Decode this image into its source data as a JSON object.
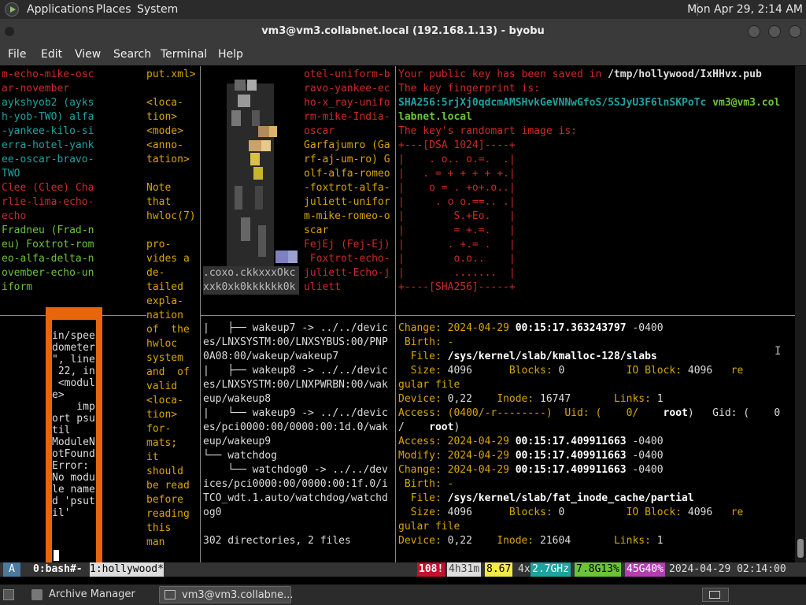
{
  "topbar": {
    "menus": [
      "Applications",
      "Places",
      "System"
    ],
    "clock": "Mon Apr 29,  2:14 AM"
  },
  "window": {
    "title": "vm3@vm3.collabnet.local (192.168.1.13) - byobu"
  },
  "menubar": [
    "File",
    "Edit",
    "View",
    "Search",
    "Terminal",
    "Help"
  ],
  "pane1": "m-echo-mike-osc\nar-november\naykshyob2 (ayks\nh-yob-TWO) alfa\n-yankee-kilo-si\nerra-hotel-yank\nee-oscar-bravo-\nTWO\nClee (Clee) Cha\nrlie-lima-echo-\necho\nFradneu (Frad-n\neu) Foxtrot-rom\neo-alfa-delta-n\november-echo-un\niform",
  "pane2": "put.xml>\n\n<loca-\ntion>\n<mode>\n<anno-\ntation>\n\nNote\nthat\nhwloc(7)\n\npro-\nvides a\nde-\ntailed\nexpla-\nnation\nof  the\nhwloc\nsystem\nand  of\nvalid\n<loca-\ntion>\nfor-\nmats;\nit\nshould\nbe read\nbefore\nreading\nthis\nman",
  "pane3_caption": ".coxo.ckkxxxOkc\nxxk0xk0kkkkkk0k",
  "pane4": "otel-uniform-b\nravo-yankee-ec\nho-x_ray-unifo\nrm-mike-India-\noscar\nGarfajumro (Ga\nrf-aj-um-ro) G\nolf-alfa-romeo\n-foxtrot-alfa-\njuliett-unifor\nm-mike-romeo-o\nscar\nFejEj (Fej-Ej)\n Foxtrot-echo-\njuliett-Echo-j\nuliett",
  "pane5": {
    "l1a": "Your public key has been saved in ",
    "l1b": "/tmp/hollywood/IxHHvx.pub",
    "l2": "The key fingerprint is:",
    "l3a": "SHA256:5rjXj0qdcmAMSHvkGeVNNwGfoS/5SJyU3F6lnSKPoTc",
    "l3b": " vm3@vm3.col",
    "l4": "labnet.local",
    "l5": "The key's randomart image is:",
    "art": "+---[DSA 1024]----+\n|    . o.. o.=.  .|\n|   . = + + + + +.|\n|    o = . +o+.o..|\n|     . o o.==.. .|\n|        S.+Eo.   |\n|        = +.=.   |\n|       . +.= .   |\n|        o.o..    |\n|        .......  |\n+----[SHA256]-----+"
  },
  "pane6": "in/spee\ndometer\n\", line\n 22, in\n <modul\ne>\n    imp\nort psu\ntil\nModuleN\notFound\nError:\nNo modu\nle name\nd 'psut\nil'",
  "pane7": "|   ├── wakeup7 -> ../../devic\nes/LNXSYSTM:00/LNXSYBUS:00/PNP\n0A08:00/wakeup/wakeup7\n|   ├── wakeup8 -> ../../devic\nes/LNXSYSTM:00/LNXPWRBN:00/wak\neup/wakeup8\n|   └── wakeup9 -> ../../devic\nes/pci0000:00/0000:00:1d.0/wak\neup/wakeup9\n└── watchdog\n    └── watchdog0 -> ../../dev\nices/pci0000:00/0000:00:1f.0/i\nTCO_wdt.1.auto/watchdog/watchd\nog0\n\n302 directories, 2 files",
  "pane8": [
    [
      "Change: ",
      "2024-04-29 ",
      "00:15:17.363243797",
      " -0400"
    ],
    [
      " Birth: -"
    ],
    [
      "  File: ",
      "/sys/kernel/slab/kmalloc-128/slabs"
    ],
    [
      "  Size: ",
      "4096",
      "      Blocks: ",
      "0",
      "          IO Block: ",
      "4096",
      "   re"
    ],
    [
      "gular file"
    ],
    [
      "Device: ",
      "0,22",
      "    Inode: ",
      "16747",
      "       Links: ",
      "1"
    ],
    [
      "Access: (0400/-r--------)  Uid: (    0/    ",
      "root",
      ")   Gid: (    0"
    ],
    [
      "/    ",
      "root",
      ")"
    ],
    [
      "Access: ",
      "2024-04-29 ",
      "00:15:17.409911663",
      " -0400"
    ],
    [
      "Modify: ",
      "2024-04-29 ",
      "00:15:17.409911663",
      " -0400"
    ],
    [
      "Change: ",
      "2024-04-29 ",
      "00:15:17.409911663",
      " -0400"
    ],
    [
      " Birth: -"
    ],
    [
      "  File: ",
      "/sys/kernel/slab/fat_inode_cache/partial"
    ],
    [
      "  Size: ",
      "4096",
      "      Blocks: ",
      "0",
      "          IO Block: ",
      "4096",
      "   re"
    ],
    [
      "gular file"
    ],
    [
      "Device: ",
      "0,22",
      "    Inode: ",
      "21604",
      "       Links: ",
      "1"
    ]
  ],
  "status": {
    "a": "A",
    "w0": "0:bash#-",
    "w1": "1:hollywood*",
    "s1": "108!",
    "s2": "4h31m",
    "s3": "8.67",
    "s4a": "4x",
    "s4b": "2.7GHz",
    "s5": "7.8G13%",
    "s6": "45G40%",
    "s7": "2024-04-29 02:14:00"
  },
  "taskbar": {
    "t1": "Archive Manager",
    "t2": "vm3@vm3.collabne..."
  },
  "colors": {
    "red": "#cc2a24",
    "teal": "#1fa2a0",
    "gold": "#d7a500",
    "orange": "#e8650c"
  }
}
